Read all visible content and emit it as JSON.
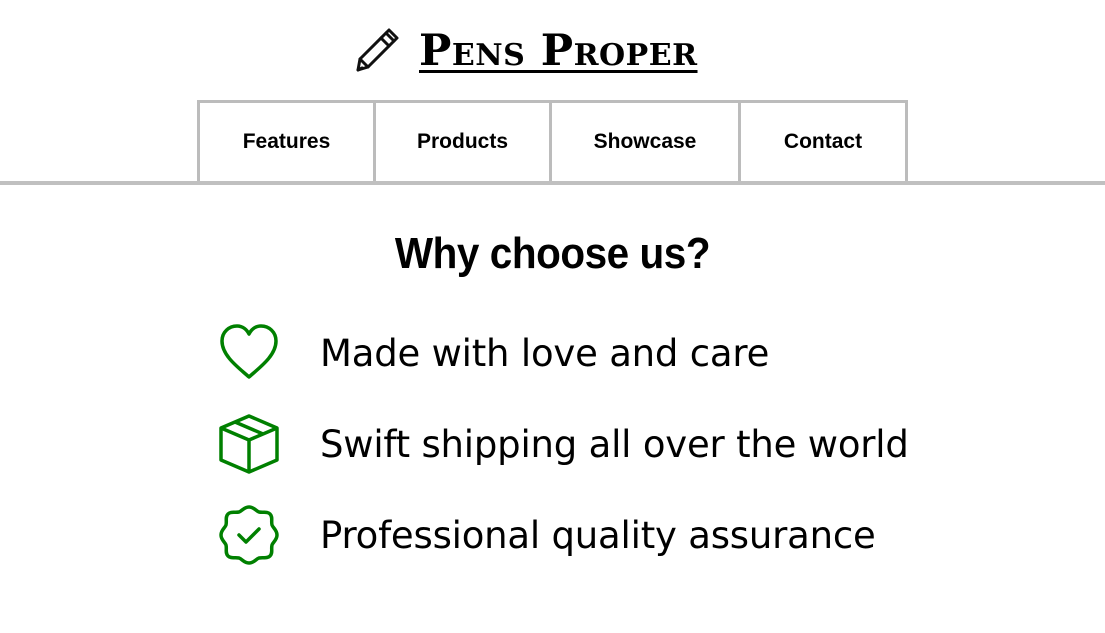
{
  "header": {
    "brand_name": "Pens Proper",
    "brand_icon": "pen-icon"
  },
  "nav": {
    "items": [
      {
        "label": "Features"
      },
      {
        "label": "Products"
      },
      {
        "label": "Showcase"
      },
      {
        "label": "Contact"
      }
    ]
  },
  "features": {
    "title": "Why choose us?",
    "accent_color": "#008000",
    "items": [
      {
        "icon": "heart-icon",
        "text": "Made with love and care"
      },
      {
        "icon": "package-icon",
        "text": "Swift shipping all over the world"
      },
      {
        "icon": "quality-badge-icon",
        "text": "Professional quality assurance"
      }
    ]
  }
}
